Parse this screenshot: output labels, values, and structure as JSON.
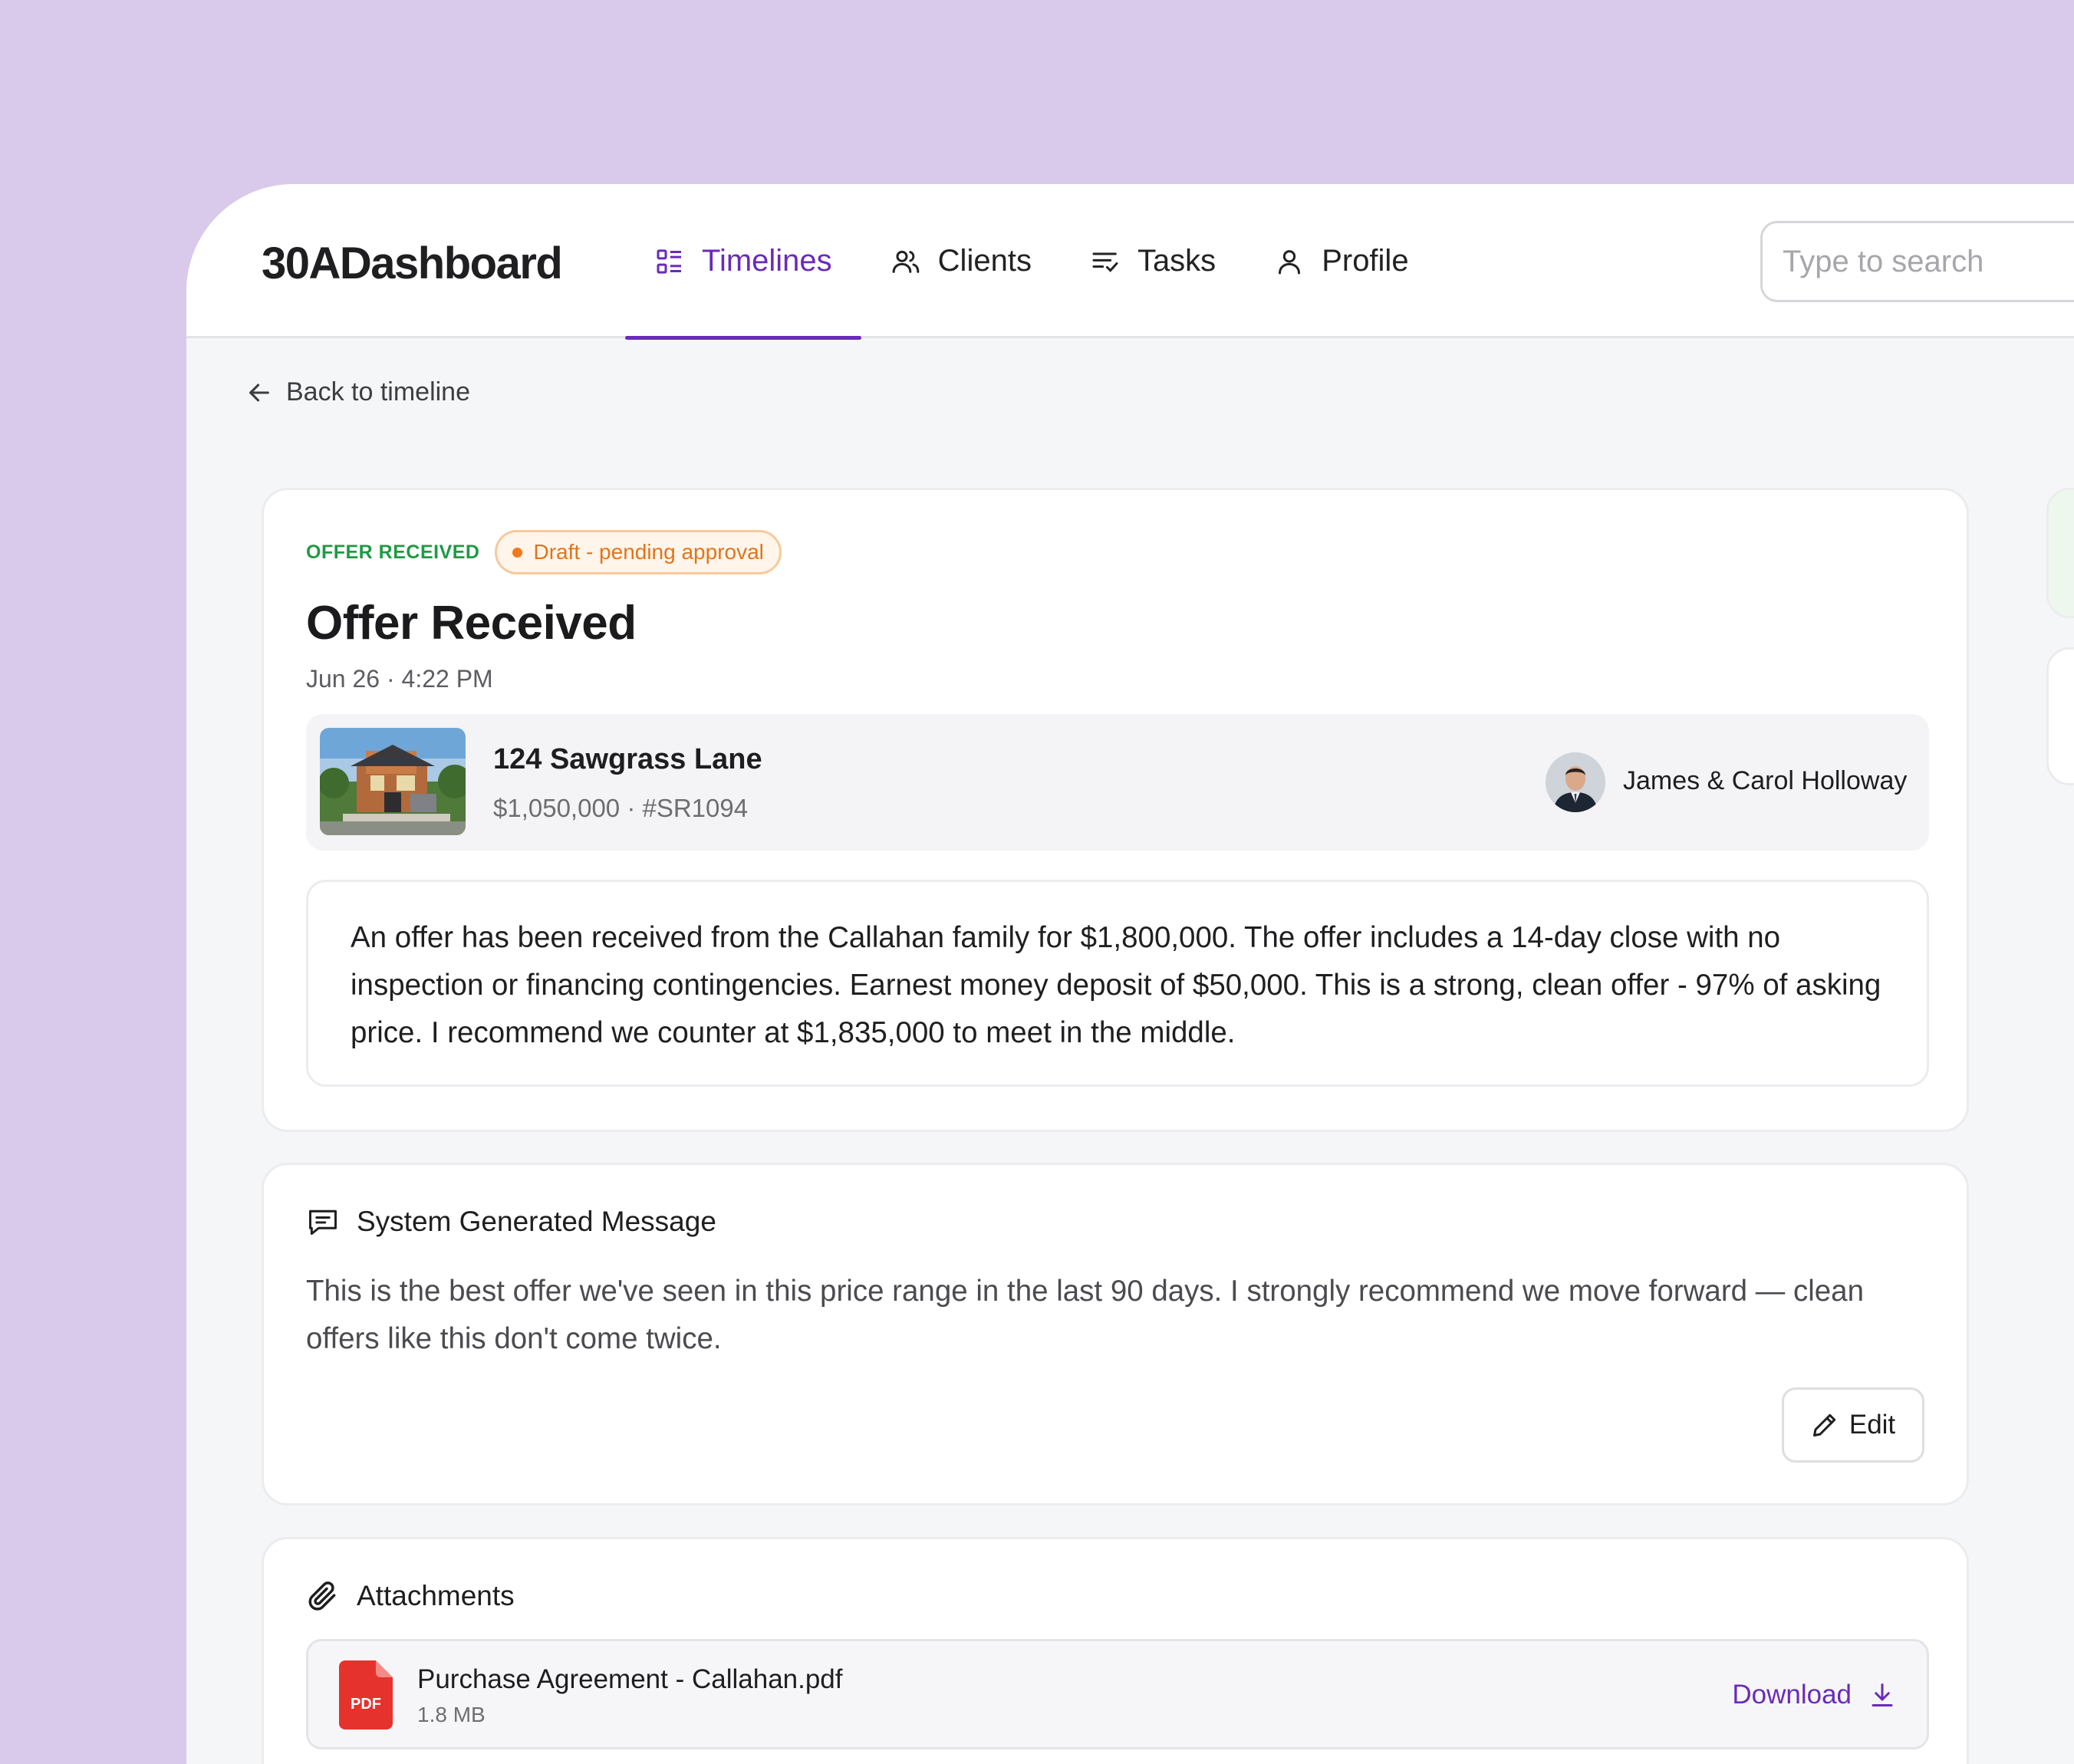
{
  "app": {
    "brand": "30ADashboard"
  },
  "nav": {
    "timelines": "Timelines",
    "clients": "Clients",
    "tasks": "Tasks",
    "profile": "Profile",
    "active": "Timelines"
  },
  "search": {
    "placeholder": "Type to search",
    "value": ""
  },
  "back": {
    "label": "Back to timeline"
  },
  "offer": {
    "status": "OFFER RECEIVED",
    "badge": "Draft - pending approval",
    "title": "Offer Received",
    "date": "Jun 26 · 4:22 PM",
    "property": {
      "address": "124 Sawgrass Lane",
      "meta": "$1,050,000 · #SR1094"
    },
    "client": {
      "name": "James & Carol Holloway"
    },
    "message": "An offer has been received from the Callahan family for $1,800,000. The offer includes a 14-day close with no inspection or financing contingencies. Earnest money deposit of $50,000. This is a strong, clean offer - 97% of asking price. I recommend we counter at $1,835,000 to meet in the middle."
  },
  "system_message": {
    "title": "System Generated Message",
    "text": "This is the best offer we've seen in this price range in the last 90 days. I strongly recommend we move forward — clean offers like this don't come twice.",
    "edit_label": "Edit"
  },
  "attachments": {
    "title": "Attachments",
    "files": [
      {
        "name": "Purchase Agreement - Callahan.pdf",
        "size": "1.8 MB",
        "icon_label": "PDF",
        "action": "Download"
      }
    ]
  },
  "colors": {
    "accent": "#6a2bb8",
    "status_green": "#1f9a45",
    "draft_orange": "#e2741a",
    "frame": "#d9c9ea",
    "pdf_red": "#e5322d"
  },
  "icons": {
    "timelines": "grid-list-icon",
    "clients": "users-icon",
    "tasks": "checklist-icon",
    "profile": "user-icon",
    "back": "arrow-left-icon",
    "message": "chat-square-icon",
    "edit": "pencil-icon",
    "attachments": "paperclip-icon",
    "download": "download-icon",
    "file": "pdf-file-icon"
  }
}
